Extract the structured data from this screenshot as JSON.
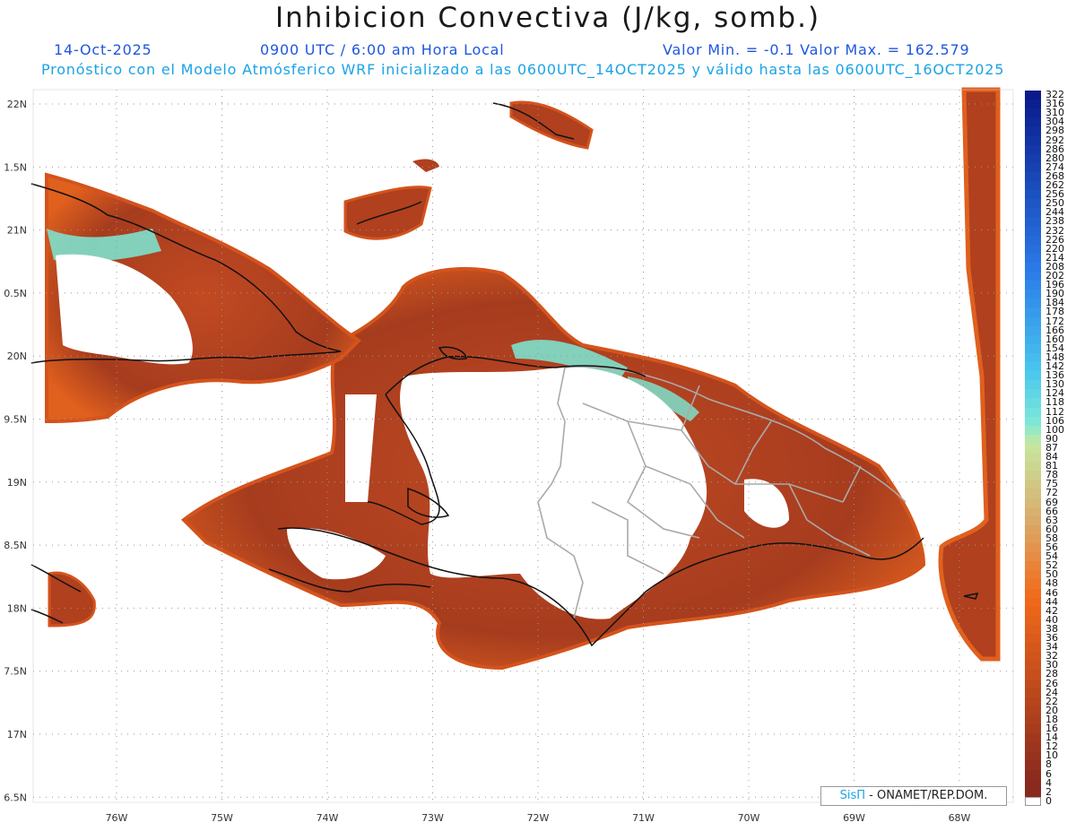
{
  "title": "Inhibicion Convectiva (J/kg, somb.)",
  "date": "14-Oct-2025",
  "time": "0900 UTC / 6:00 am Hora Local",
  "minmax": "Valor Min. = -0.1  Valor Max. = 162.579",
  "description": "Pronóstico con el Modelo Atmósferico WRF inicializado a las 0600UTC_14OCT2025 y válido hasta las  0600UTC_16OCT2025",
  "credit": {
    "sis": "SisΠ",
    "rest": " - ONAMET/REP.DOM."
  },
  "map": {
    "lat_labels": [
      "22N",
      "1.5N",
      "21N",
      "0.5N",
      "20N",
      "9.5N",
      "19N",
      "8.5N",
      "18N",
      "7.5N",
      "17N",
      "6.5N"
    ],
    "lon_labels": [
      "76W",
      "75W",
      "74W",
      "73W",
      "72W",
      "71W",
      "70W",
      "69W",
      "68W"
    ]
  },
  "legend": {
    "values": [
      "322",
      "316",
      "310",
      "304",
      "298",
      "292",
      "286",
      "280",
      "274",
      "268",
      "262",
      "256",
      "250",
      "244",
      "238",
      "232",
      "226",
      "220",
      "214",
      "208",
      "202",
      "196",
      "190",
      "184",
      "178",
      "172",
      "166",
      "160",
      "154",
      "148",
      "142",
      "136",
      "130",
      "124",
      "118",
      "112",
      "106",
      "100",
      "90",
      "87",
      "84",
      "81",
      "78",
      "75",
      "72",
      "69",
      "66",
      "63",
      "60",
      "58",
      "56",
      "54",
      "52",
      "50",
      "48",
      "46",
      "44",
      "42",
      "40",
      "38",
      "36",
      "34",
      "32",
      "30",
      "28",
      "26",
      "24",
      "22",
      "20",
      "18",
      "16",
      "14",
      "12",
      "10",
      "8",
      "6",
      "4",
      "2",
      "0"
    ],
    "colors": {
      "high": "#0a1a8a",
      "mid": "#4ac8ee",
      "cyan": "#7ee8d8",
      "green": "#c6e8a0",
      "tan": "#d8b070",
      "orange": "#f26a1a",
      "brown": "#8a2a1e",
      "zero": "#ffffff"
    }
  },
  "colors": {
    "land_fill": "#b0401e",
    "land_edge": "#d4531c",
    "cyan_band": "#7ee0cc",
    "border": "#aaaaaa",
    "coast": "#111111"
  }
}
